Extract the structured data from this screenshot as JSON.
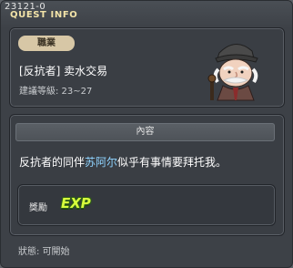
{
  "window": {
    "quest_id": "23121-0",
    "title": "QUEST INFO"
  },
  "top_panel": {
    "job_badge": "職業",
    "quest_name": "[反抗者] 卖水交易",
    "required_level": "建議等級: 23~27"
  },
  "content": {
    "header": "內容",
    "text_before": "反抗者的同伴",
    "highlight": "苏阿尔",
    "text_after": "似乎有事情要拜托我。",
    "highlight_color": "#8fd3ff"
  },
  "reward": {
    "label": "獎勵",
    "exp_icon_text": "EXP"
  },
  "status": {
    "text": "狀態: 可開始"
  },
  "icons": [
    "npc-old-man-portrait-icon",
    "exp-reward-icon"
  ]
}
